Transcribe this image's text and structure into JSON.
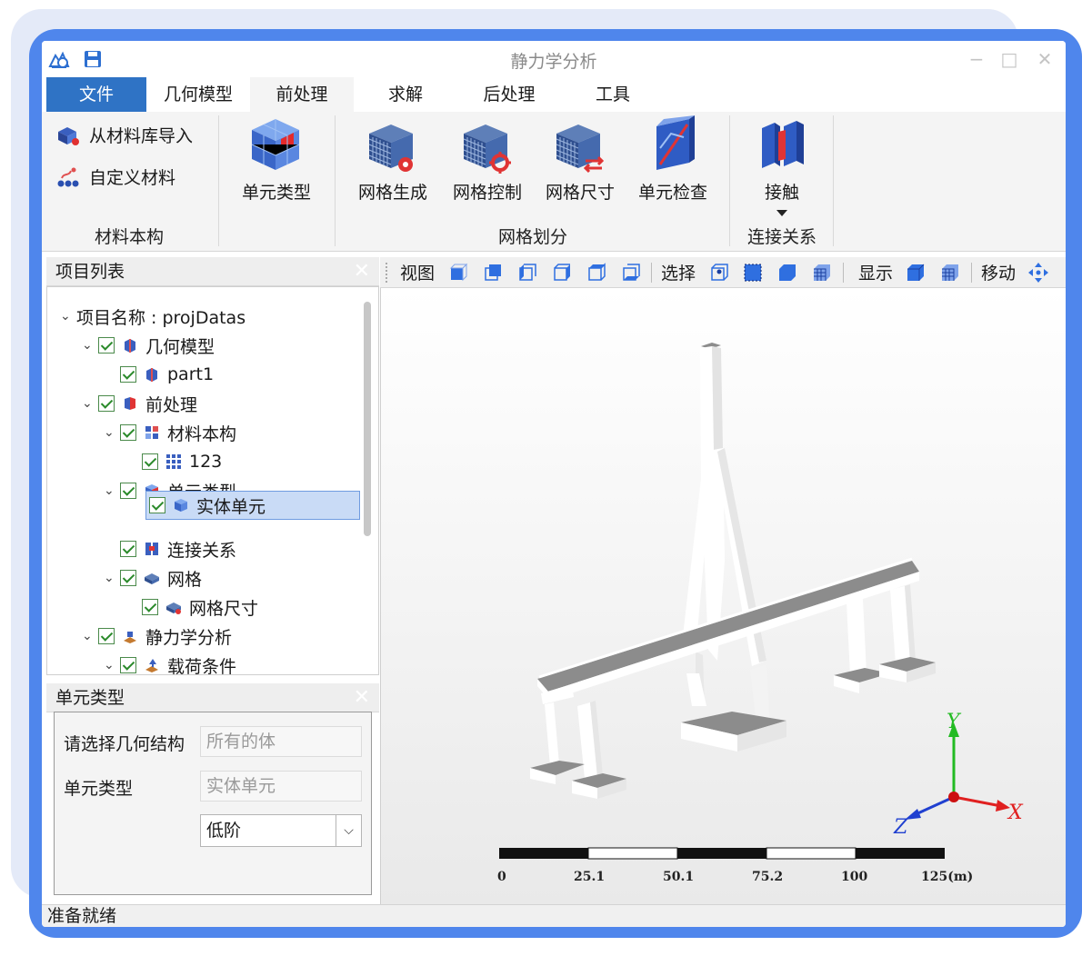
{
  "window": {
    "title": "静力学分析",
    "controls": {
      "minimize": "−",
      "maximize": "□",
      "close": "✕"
    }
  },
  "tabs": [
    {
      "label": "文件"
    },
    {
      "label": "几何模型"
    },
    {
      "label": "前处理"
    },
    {
      "label": "求解"
    },
    {
      "label": "后处理"
    },
    {
      "label": "工具"
    }
  ],
  "ribbon": {
    "material_group": {
      "label": "材料本构",
      "import_label": "从材料库导入",
      "custom_label": "自定义材料"
    },
    "element_type_label": "单元类型",
    "mesh_group": {
      "label": "网格划分",
      "generate_label": "网格生成",
      "control_label": "网格控制",
      "size_label": "网格尺寸",
      "check_label": "单元检查"
    },
    "connection_group": {
      "label": "连接关系",
      "contact_label": "接触"
    }
  },
  "project_panel": {
    "title": "项目列表",
    "close": "✕",
    "tree": [
      {
        "label": "项目名称 : projDatas"
      },
      {
        "label": "几何模型"
      },
      {
        "label": "part1"
      },
      {
        "label": "前处理"
      },
      {
        "label": "材料本构"
      },
      {
        "label": "123"
      },
      {
        "label": "单元类型"
      },
      {
        "label": "实体单元"
      },
      {
        "label": "连接关系"
      },
      {
        "label": "网格"
      },
      {
        "label": "网格尺寸"
      },
      {
        "label": "静力学分析"
      },
      {
        "label": "载荷条件"
      }
    ]
  },
  "element_panel": {
    "title": "单元类型",
    "close": "✕",
    "geometry_label": "请选择几何结构",
    "geometry_value": "所有的体",
    "type_label": "单元类型",
    "type_value": "实体单元",
    "order_value": "低阶"
  },
  "view_toolbar": {
    "view_label": "视图",
    "select_label": "选择",
    "display_label": "显示",
    "move_label": "移动"
  },
  "viewport": {
    "axes": {
      "x": "X",
      "y": "Y",
      "z": "Z"
    },
    "scale_labels": [
      "0",
      "25.1",
      "50.1",
      "75.2",
      "100",
      "125(m)"
    ],
    "colors": {
      "x_axis": "#e02020",
      "y_axis": "#22bb22",
      "z_axis": "#2040d0",
      "deck": "#8c8c8c"
    }
  },
  "status": {
    "text": "准备就绪"
  }
}
